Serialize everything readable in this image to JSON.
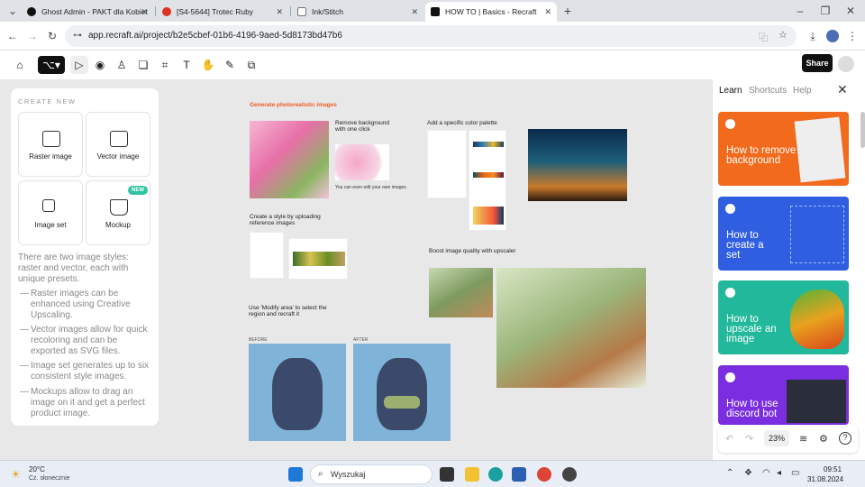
{
  "browser": {
    "tabs": [
      {
        "label": "Ghost Admin - PAKT dla Kobiet",
        "active": false
      },
      {
        "label": "[S4-5644] Trotec Ruby",
        "active": false
      },
      {
        "label": "Ink/Stitch",
        "active": false
      },
      {
        "label": "HOW TO | Basics - Recraft",
        "active": true
      }
    ],
    "url": "app.recraft.ai/project/b2e5cbef-01b6-4196-9aed-5d8173bd47b6"
  },
  "toolbar": {
    "share_label": "Share"
  },
  "create_panel": {
    "heading": "CREATE NEW",
    "tiles": [
      {
        "label": "Raster image",
        "icon": "raster-image-icon"
      },
      {
        "label": "Vector image",
        "icon": "vector-image-icon"
      },
      {
        "label": "Image set",
        "icon": "image-set-icon"
      },
      {
        "label": "Mockup",
        "icon": "mockup-icon",
        "badge": "NEW"
      }
    ],
    "intro": "There are two image styles: raster and vector, each with unique presets.",
    "bullets": [
      "Raster images can be enhanced using Creative Upscaling.",
      "Vector images allow for quick recoloring and can be exported as SVG files.",
      "Image set generates up to six consistent style images.",
      "Mockups allow to drag an image on it and get a perfect product image."
    ]
  },
  "board": {
    "photo_title": "Generate photorealistic images",
    "remove_bg_title": "Remove background with one click",
    "edit_own": "You can even edit your own images",
    "palette_title": "Add a specific color palette",
    "style_title": "Create a style by uploading reference images",
    "upscale_title": "Boost image quality with upscaler",
    "modify_title": "Use 'Modify area' to select the region and recraft it",
    "before_label": "BEFORE",
    "after_label": "AFTER"
  },
  "side_panel": {
    "tabs": [
      "Learn",
      "Shortcuts",
      "Help"
    ],
    "active_tab": "Learn",
    "cards": [
      {
        "title": "How to remove background",
        "color": "#f26a1b"
      },
      {
        "title": "How to create a set",
        "color": "#2f5ee0"
      },
      {
        "title": "How to upscale an image",
        "color": "#21b89b"
      },
      {
        "title": "How to use discord bot",
        "color": "#7a2ee0"
      }
    ],
    "zoom": "23%"
  },
  "taskbar": {
    "weather_temp": "20°C",
    "weather_desc": "Cz. słonecznie",
    "search_placeholder": "Wyszukaj",
    "time": "09:51",
    "date": "31.08.2024"
  }
}
